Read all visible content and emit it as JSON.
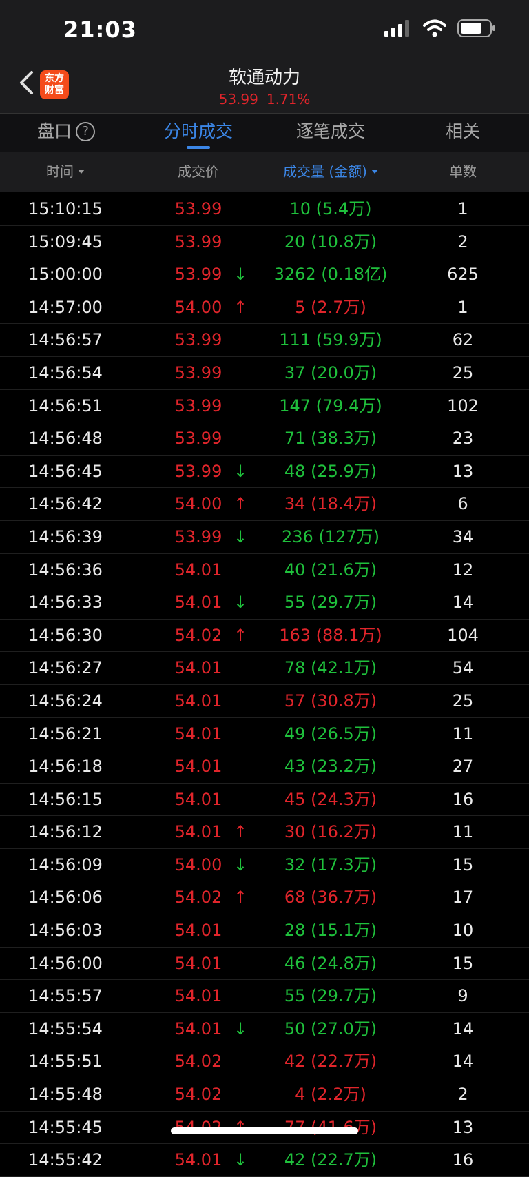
{
  "status": {
    "time": "21:03",
    "icons": [
      "signal-icon",
      "wifi-icon",
      "battery-icon"
    ]
  },
  "header": {
    "title": "软通动力",
    "price": "53.99",
    "change_pct": "1.71%",
    "logo_line1": "东方",
    "logo_line2": "财富"
  },
  "tabs": [
    {
      "label": "盘口",
      "active": false
    },
    {
      "label": "分时成交",
      "active": true
    },
    {
      "label": "逐笔成交",
      "active": false
    },
    {
      "label": "相关",
      "active": false
    }
  ],
  "columns": {
    "time": "时间",
    "price": "成交价",
    "volume": "成交量 (金额)",
    "count": "单数"
  },
  "colors": {
    "up": "#e0252b",
    "down": "#1fc03c",
    "accent": "#3b86e6"
  },
  "rows": [
    {
      "time": "15:10:15",
      "price": "53.99",
      "arrow": "",
      "volume": "10 (5.4万)",
      "dir": "down",
      "count": "1"
    },
    {
      "time": "15:09:45",
      "price": "53.99",
      "arrow": "",
      "volume": "20 (10.8万)",
      "dir": "down",
      "count": "2"
    },
    {
      "time": "15:00:00",
      "price": "53.99",
      "arrow": "↓",
      "volume": "3262 (0.18亿)",
      "dir": "down",
      "count": "625"
    },
    {
      "time": "14:57:00",
      "price": "54.00",
      "arrow": "↑",
      "volume": "5 (2.7万)",
      "dir": "up",
      "count": "1"
    },
    {
      "time": "14:56:57",
      "price": "53.99",
      "arrow": "",
      "volume": "111 (59.9万)",
      "dir": "down",
      "count": "62"
    },
    {
      "time": "14:56:54",
      "price": "53.99",
      "arrow": "",
      "volume": "37 (20.0万)",
      "dir": "down",
      "count": "25"
    },
    {
      "time": "14:56:51",
      "price": "53.99",
      "arrow": "",
      "volume": "147 (79.4万)",
      "dir": "down",
      "count": "102"
    },
    {
      "time": "14:56:48",
      "price": "53.99",
      "arrow": "",
      "volume": "71 (38.3万)",
      "dir": "down",
      "count": "23"
    },
    {
      "time": "14:56:45",
      "price": "53.99",
      "arrow": "↓",
      "volume": "48 (25.9万)",
      "dir": "down",
      "count": "13"
    },
    {
      "time": "14:56:42",
      "price": "54.00",
      "arrow": "↑",
      "volume": "34 (18.4万)",
      "dir": "up",
      "count": "6"
    },
    {
      "time": "14:56:39",
      "price": "53.99",
      "arrow": "↓",
      "volume": "236 (127万)",
      "dir": "down",
      "count": "34"
    },
    {
      "time": "14:56:36",
      "price": "54.01",
      "arrow": "",
      "volume": "40 (21.6万)",
      "dir": "down",
      "count": "12"
    },
    {
      "time": "14:56:33",
      "price": "54.01",
      "arrow": "↓",
      "volume": "55 (29.7万)",
      "dir": "down",
      "count": "14"
    },
    {
      "time": "14:56:30",
      "price": "54.02",
      "arrow": "↑",
      "volume": "163 (88.1万)",
      "dir": "up",
      "count": "104"
    },
    {
      "time": "14:56:27",
      "price": "54.01",
      "arrow": "",
      "volume": "78 (42.1万)",
      "dir": "down",
      "count": "54"
    },
    {
      "time": "14:56:24",
      "price": "54.01",
      "arrow": "",
      "volume": "57 (30.8万)",
      "dir": "up",
      "count": "25"
    },
    {
      "time": "14:56:21",
      "price": "54.01",
      "arrow": "",
      "volume": "49 (26.5万)",
      "dir": "down",
      "count": "11"
    },
    {
      "time": "14:56:18",
      "price": "54.01",
      "arrow": "",
      "volume": "43 (23.2万)",
      "dir": "down",
      "count": "27"
    },
    {
      "time": "14:56:15",
      "price": "54.01",
      "arrow": "",
      "volume": "45 (24.3万)",
      "dir": "up",
      "count": "16"
    },
    {
      "time": "14:56:12",
      "price": "54.01",
      "arrow": "↑",
      "volume": "30 (16.2万)",
      "dir": "up",
      "count": "11"
    },
    {
      "time": "14:56:09",
      "price": "54.00",
      "arrow": "↓",
      "volume": "32 (17.3万)",
      "dir": "down",
      "count": "15"
    },
    {
      "time": "14:56:06",
      "price": "54.02",
      "arrow": "↑",
      "volume": "68 (36.7万)",
      "dir": "up",
      "count": "17"
    },
    {
      "time": "14:56:03",
      "price": "54.01",
      "arrow": "",
      "volume": "28 (15.1万)",
      "dir": "down",
      "count": "10"
    },
    {
      "time": "14:56:00",
      "price": "54.01",
      "arrow": "",
      "volume": "46 (24.8万)",
      "dir": "down",
      "count": "15"
    },
    {
      "time": "14:55:57",
      "price": "54.01",
      "arrow": "",
      "volume": "55 (29.7万)",
      "dir": "down",
      "count": "9"
    },
    {
      "time": "14:55:54",
      "price": "54.01",
      "arrow": "↓",
      "volume": "50 (27.0万)",
      "dir": "down",
      "count": "14"
    },
    {
      "time": "14:55:51",
      "price": "54.02",
      "arrow": "",
      "volume": "42 (22.7万)",
      "dir": "up",
      "count": "14"
    },
    {
      "time": "14:55:48",
      "price": "54.02",
      "arrow": "",
      "volume": "4 (2.2万)",
      "dir": "up",
      "count": "2"
    },
    {
      "time": "14:55:45",
      "price": "54.02",
      "arrow": "↑",
      "volume": "77 (41.6万)",
      "dir": "up",
      "count": "13"
    },
    {
      "time": "14:55:42",
      "price": "54.01",
      "arrow": "↓",
      "volume": "42 (22.7万)",
      "dir": "down",
      "count": "16"
    }
  ]
}
